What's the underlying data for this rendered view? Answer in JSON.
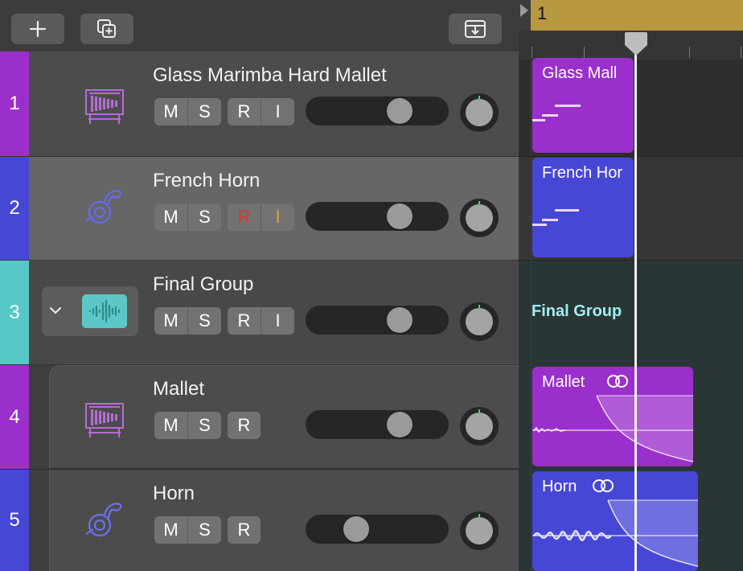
{
  "toolbar": {
    "add_icon": "plus-icon",
    "duplicate_icon": "duplicate-track-icon",
    "download_icon": "download-icon"
  },
  "ruler": {
    "bar_number": "1"
  },
  "tracks": [
    {
      "number": "1",
      "name": "Glass Marimba Hard Mallet",
      "icon": "marimba-icon",
      "color": "#9b2fcc",
      "buttons": [
        "M",
        "S",
        "R",
        "I"
      ],
      "volume": 0.7
    },
    {
      "number": "2",
      "name": "French Horn",
      "icon": "french-horn-icon",
      "color": "#4747d6",
      "buttons": [
        "M",
        "S",
        "R",
        "I"
      ],
      "volume": 0.7
    },
    {
      "number": "3",
      "name": "Final Group",
      "icon": "waveform-icon",
      "color": "#56c8c8",
      "buttons": [
        "M",
        "S",
        "R",
        "I"
      ],
      "volume": 0.7
    },
    {
      "number": "4",
      "name": "Mallet",
      "icon": "marimba-icon",
      "color": "#9b2fcc",
      "buttons": [
        "M",
        "S",
        "R"
      ],
      "volume": 0.7
    },
    {
      "number": "5",
      "name": "Horn",
      "icon": "french-horn-icon",
      "color": "#4747d6",
      "buttons": [
        "M",
        "S",
        "R"
      ],
      "volume": 0.32
    }
  ],
  "regions": [
    {
      "label": "Glass Mall"
    },
    {
      "label": "French Hor"
    },
    {
      "label": "Final Group"
    },
    {
      "label": "Mallet"
    },
    {
      "label": "Horn"
    }
  ],
  "colors": {
    "purple": "#9b2fcc",
    "blue": "#4747d6",
    "teal": "#56c8c8",
    "ruler": "#b8983e",
    "record": "#d9382e",
    "input": "#e1a23a"
  }
}
